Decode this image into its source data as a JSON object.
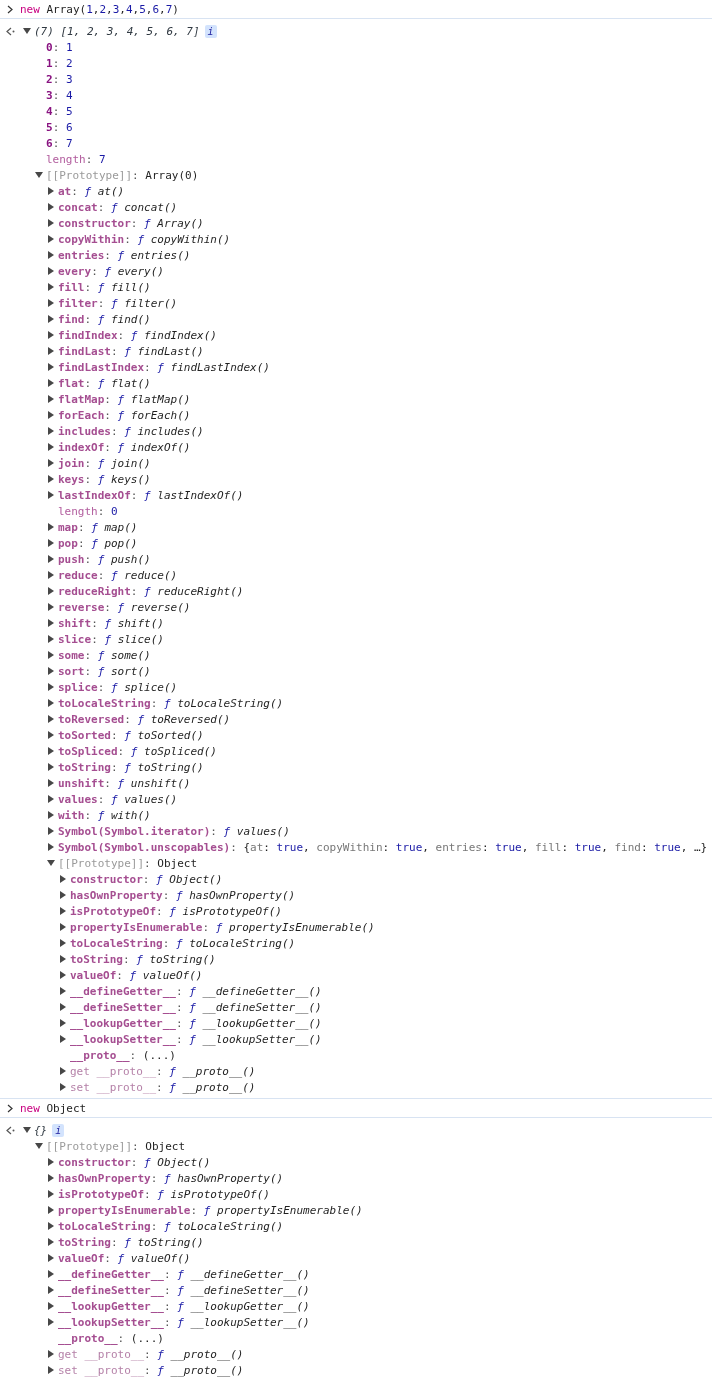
{
  "console": {
    "separator": ":",
    "comma": ",",
    "entries": [
      {
        "input": [
          {
            "t": "new",
            "kind": "keyword"
          },
          {
            "t": " Array(",
            "kind": "plain"
          },
          {
            "t": "1",
            "kind": "number"
          },
          {
            "t": ",",
            "kind": "plain"
          },
          {
            "t": "2",
            "kind": "number"
          },
          {
            "t": ",",
            "kind": "plain"
          },
          {
            "t": "3",
            "kind": "number"
          },
          {
            "t": ",",
            "kind": "plain"
          },
          {
            "t": "4",
            "kind": "number"
          },
          {
            "t": ",",
            "kind": "plain"
          },
          {
            "t": "5",
            "kind": "number"
          },
          {
            "t": ",",
            "kind": "plain"
          },
          {
            "t": "6",
            "kind": "number"
          },
          {
            "t": ",",
            "kind": "plain"
          },
          {
            "t": "7",
            "kind": "number"
          },
          {
            "t": ")",
            "kind": "plain"
          }
        ],
        "result": {
          "summary": "(7) [1, 2, 3, 4, 5, 6, 7]",
          "badge": "i",
          "expanded": true,
          "children": [
            {
              "key": "0",
              "kind": "index",
              "value": "1"
            },
            {
              "key": "1",
              "kind": "index",
              "value": "2"
            },
            {
              "key": "2",
              "kind": "index",
              "value": "3"
            },
            {
              "key": "3",
              "kind": "index",
              "value": "4"
            },
            {
              "key": "4",
              "kind": "index",
              "value": "5"
            },
            {
              "key": "5",
              "kind": "index",
              "value": "6"
            },
            {
              "key": "6",
              "kind": "index",
              "value": "7"
            },
            {
              "key": "length",
              "kind": "length",
              "value": "7"
            },
            {
              "key": "[[Prototype]]",
              "kind": "proto",
              "value": "Array(0)",
              "expanded": true,
              "children": [
                {
                  "key": "at",
                  "kind": "method",
                  "fn": "ƒ",
                  "value": "at()",
                  "expanded": false
                },
                {
                  "key": "concat",
                  "kind": "method",
                  "fn": "ƒ",
                  "value": "concat()",
                  "expanded": false
                },
                {
                  "key": "constructor",
                  "kind": "method",
                  "fn": "ƒ",
                  "value": "Array()",
                  "expanded": false
                },
                {
                  "key": "copyWithin",
                  "kind": "method",
                  "fn": "ƒ",
                  "value": "copyWithin()",
                  "expanded": false
                },
                {
                  "key": "entries",
                  "kind": "method",
                  "fn": "ƒ",
                  "value": "entries()",
                  "expanded": false
                },
                {
                  "key": "every",
                  "kind": "method",
                  "fn": "ƒ",
                  "value": "every()",
                  "expanded": false
                },
                {
                  "key": "fill",
                  "kind": "method",
                  "fn": "ƒ",
                  "value": "fill()",
                  "expanded": false
                },
                {
                  "key": "filter",
                  "kind": "method",
                  "fn": "ƒ",
                  "value": "filter()",
                  "expanded": false
                },
                {
                  "key": "find",
                  "kind": "method",
                  "fn": "ƒ",
                  "value": "find()",
                  "expanded": false
                },
                {
                  "key": "findIndex",
                  "kind": "method",
                  "fn": "ƒ",
                  "value": "findIndex()",
                  "expanded": false
                },
                {
                  "key": "findLast",
                  "kind": "method",
                  "fn": "ƒ",
                  "value": "findLast()",
                  "expanded": false
                },
                {
                  "key": "findLastIndex",
                  "kind": "method",
                  "fn": "ƒ",
                  "value": "findLastIndex()",
                  "expanded": false
                },
                {
                  "key": "flat",
                  "kind": "method",
                  "fn": "ƒ",
                  "value": "flat()",
                  "expanded": false
                },
                {
                  "key": "flatMap",
                  "kind": "method",
                  "fn": "ƒ",
                  "value": "flatMap()",
                  "expanded": false
                },
                {
                  "key": "forEach",
                  "kind": "method",
                  "fn": "ƒ",
                  "value": "forEach()",
                  "expanded": false
                },
                {
                  "key": "includes",
                  "kind": "method",
                  "fn": "ƒ",
                  "value": "includes()",
                  "expanded": false
                },
                {
                  "key": "indexOf",
                  "kind": "method",
                  "fn": "ƒ",
                  "value": "indexOf()",
                  "expanded": false
                },
                {
                  "key": "join",
                  "kind": "method",
                  "fn": "ƒ",
                  "value": "join()",
                  "expanded": false
                },
                {
                  "key": "keys",
                  "kind": "method",
                  "fn": "ƒ",
                  "value": "keys()",
                  "expanded": false
                },
                {
                  "key": "lastIndexOf",
                  "kind": "method",
                  "fn": "ƒ",
                  "value": "lastIndexOf()",
                  "expanded": false
                },
                {
                  "key": "length",
                  "kind": "length",
                  "value": "0"
                },
                {
                  "key": "map",
                  "kind": "method",
                  "fn": "ƒ",
                  "value": "map()",
                  "expanded": false
                },
                {
                  "key": "pop",
                  "kind": "method",
                  "fn": "ƒ",
                  "value": "pop()",
                  "expanded": false
                },
                {
                  "key": "push",
                  "kind": "method",
                  "fn": "ƒ",
                  "value": "push()",
                  "expanded": false
                },
                {
                  "key": "reduce",
                  "kind": "method",
                  "fn": "ƒ",
                  "value": "reduce()",
                  "expanded": false
                },
                {
                  "key": "reduceRight",
                  "kind": "method",
                  "fn": "ƒ",
                  "value": "reduceRight()",
                  "expanded": false
                },
                {
                  "key": "reverse",
                  "kind": "method",
                  "fn": "ƒ",
                  "value": "reverse()",
                  "expanded": false
                },
                {
                  "key": "shift",
                  "kind": "method",
                  "fn": "ƒ",
                  "value": "shift()",
                  "expanded": false
                },
                {
                  "key": "slice",
                  "kind": "method",
                  "fn": "ƒ",
                  "value": "slice()",
                  "expanded": false
                },
                {
                  "key": "some",
                  "kind": "method",
                  "fn": "ƒ",
                  "value": "some()",
                  "expanded": false
                },
                {
                  "key": "sort",
                  "kind": "method",
                  "fn": "ƒ",
                  "value": "sort()",
                  "expanded": false
                },
                {
                  "key": "splice",
                  "kind": "method",
                  "fn": "ƒ",
                  "value": "splice()",
                  "expanded": false
                },
                {
                  "key": "toLocaleString",
                  "kind": "method",
                  "fn": "ƒ",
                  "value": "toLocaleString()",
                  "expanded": false
                },
                {
                  "key": "toReversed",
                  "kind": "method",
                  "fn": "ƒ",
                  "value": "toReversed()",
                  "expanded": false
                },
                {
                  "key": "toSorted",
                  "kind": "method",
                  "fn": "ƒ",
                  "value": "toSorted()",
                  "expanded": false
                },
                {
                  "key": "toSpliced",
                  "kind": "method",
                  "fn": "ƒ",
                  "value": "toSpliced()",
                  "expanded": false
                },
                {
                  "key": "toString",
                  "kind": "method",
                  "fn": "ƒ",
                  "value": "toString()",
                  "expanded": false
                },
                {
                  "key": "unshift",
                  "kind": "method",
                  "fn": "ƒ",
                  "value": "unshift()",
                  "expanded": false
                },
                {
                  "key": "values",
                  "kind": "method",
                  "fn": "ƒ",
                  "value": "values()",
                  "expanded": false
                },
                {
                  "key": "with",
                  "kind": "method",
                  "fn": "ƒ",
                  "value": "with()",
                  "expanded": false
                },
                {
                  "key": "Symbol(Symbol.iterator)",
                  "kind": "method",
                  "fn": "ƒ",
                  "value": "values()",
                  "expanded": false
                },
                {
                  "key": "Symbol(Symbol.unscopables)",
                  "kind": "symbol",
                  "open": "{",
                  "close": "}",
                  "more": "…",
                  "preview": [
                    {
                      "key": "at",
                      "value": "true"
                    },
                    {
                      "key": "copyWithin",
                      "value": "true"
                    },
                    {
                      "key": "entries",
                      "value": "true"
                    },
                    {
                      "key": "fill",
                      "value": "true"
                    },
                    {
                      "key": "find",
                      "value": "true"
                    }
                  ],
                  "expanded": false
                },
                {
                  "key": "[[Prototype]]",
                  "kind": "proto",
                  "value": "Object",
                  "expanded": true,
                  "children": [
                    {
                      "key": "constructor",
                      "kind": "method",
                      "fn": "ƒ",
                      "value": "Object()",
                      "expanded": false
                    },
                    {
                      "key": "hasOwnProperty",
                      "kind": "method",
                      "fn": "ƒ",
                      "value": "hasOwnProperty()",
                      "expanded": false
                    },
                    {
                      "key": "isPrototypeOf",
                      "kind": "method",
                      "fn": "ƒ",
                      "value": "isPrototypeOf()",
                      "expanded": false
                    },
                    {
                      "key": "propertyIsEnumerable",
                      "kind": "method",
                      "fn": "ƒ",
                      "value": "propertyIsEnumerable()",
                      "expanded": false
                    },
                    {
                      "key": "toLocaleString",
                      "kind": "method",
                      "fn": "ƒ",
                      "value": "toLocaleString()",
                      "expanded": false
                    },
                    {
                      "key": "toString",
                      "kind": "method",
                      "fn": "ƒ",
                      "value": "toString()",
                      "expanded": false
                    },
                    {
                      "key": "valueOf",
                      "kind": "method",
                      "fn": "ƒ",
                      "value": "valueOf()",
                      "expanded": false
                    },
                    {
                      "key": "__defineGetter__",
                      "kind": "method",
                      "fn": "ƒ",
                      "value": "__defineGetter__()",
                      "expanded": false
                    },
                    {
                      "key": "__defineSetter__",
                      "kind": "method",
                      "fn": "ƒ",
                      "value": "__defineSetter__()",
                      "expanded": false
                    },
                    {
                      "key": "__lookupGetter__",
                      "kind": "method",
                      "fn": "ƒ",
                      "value": "__lookupGetter__()",
                      "expanded": false
                    },
                    {
                      "key": "__lookupSetter__",
                      "kind": "method",
                      "fn": "ƒ",
                      "value": "__lookupSetter__()",
                      "expanded": false
                    },
                    {
                      "key": "__proto__",
                      "kind": "getter",
                      "value": "(...)"
                    },
                    {
                      "key": "get __proto__",
                      "kind": "accessor",
                      "fn": "ƒ",
                      "value": "__proto__()",
                      "expanded": false
                    },
                    {
                      "key": "set __proto__",
                      "kind": "accessor",
                      "fn": "ƒ",
                      "value": "__proto__()",
                      "expanded": false
                    }
                  ]
                }
              ]
            }
          ]
        }
      },
      {
        "input": [
          {
            "t": "new",
            "kind": "keyword"
          },
          {
            "t": " Object",
            "kind": "plain"
          }
        ],
        "result": {
          "summary": "{}",
          "badge": "i",
          "expanded": true,
          "children": [
            {
              "key": "[[Prototype]]",
              "kind": "proto",
              "value": "Object",
              "expanded": true,
              "children": [
                {
                  "key": "constructor",
                  "kind": "method",
                  "fn": "ƒ",
                  "value": "Object()",
                  "expanded": false
                },
                {
                  "key": "hasOwnProperty",
                  "kind": "method",
                  "fn": "ƒ",
                  "value": "hasOwnProperty()",
                  "expanded": false
                },
                {
                  "key": "isPrototypeOf",
                  "kind": "method",
                  "fn": "ƒ",
                  "value": "isPrototypeOf()",
                  "expanded": false
                },
                {
                  "key": "propertyIsEnumerable",
                  "kind": "method",
                  "fn": "ƒ",
                  "value": "propertyIsEnumerable()",
                  "expanded": false
                },
                {
                  "key": "toLocaleString",
                  "kind": "method",
                  "fn": "ƒ",
                  "value": "toLocaleString()",
                  "expanded": false
                },
                {
                  "key": "toString",
                  "kind": "method",
                  "fn": "ƒ",
                  "value": "toString()",
                  "expanded": false
                },
                {
                  "key": "valueOf",
                  "kind": "method",
                  "fn": "ƒ",
                  "value": "valueOf()",
                  "expanded": false
                },
                {
                  "key": "__defineGetter__",
                  "kind": "method",
                  "fn": "ƒ",
                  "value": "__defineGetter__()",
                  "expanded": false
                },
                {
                  "key": "__defineSetter__",
                  "kind": "method",
                  "fn": "ƒ",
                  "value": "__defineSetter__()",
                  "expanded": false
                },
                {
                  "key": "__lookupGetter__",
                  "kind": "method",
                  "fn": "ƒ",
                  "value": "__lookupGetter__()",
                  "expanded": false
                },
                {
                  "key": "__lookupSetter__",
                  "kind": "method",
                  "fn": "ƒ",
                  "value": "__lookupSetter__()",
                  "expanded": false
                },
                {
                  "key": "__proto__",
                  "kind": "getter",
                  "value": "(...)"
                },
                {
                  "key": "get __proto__",
                  "kind": "accessor",
                  "fn": "ƒ",
                  "value": "__proto__()",
                  "expanded": false
                },
                {
                  "key": "set __proto__",
                  "kind": "accessor",
                  "fn": "ƒ",
                  "value": "__proto__()",
                  "expanded": false
                }
              ]
            }
          ]
        }
      }
    ]
  }
}
